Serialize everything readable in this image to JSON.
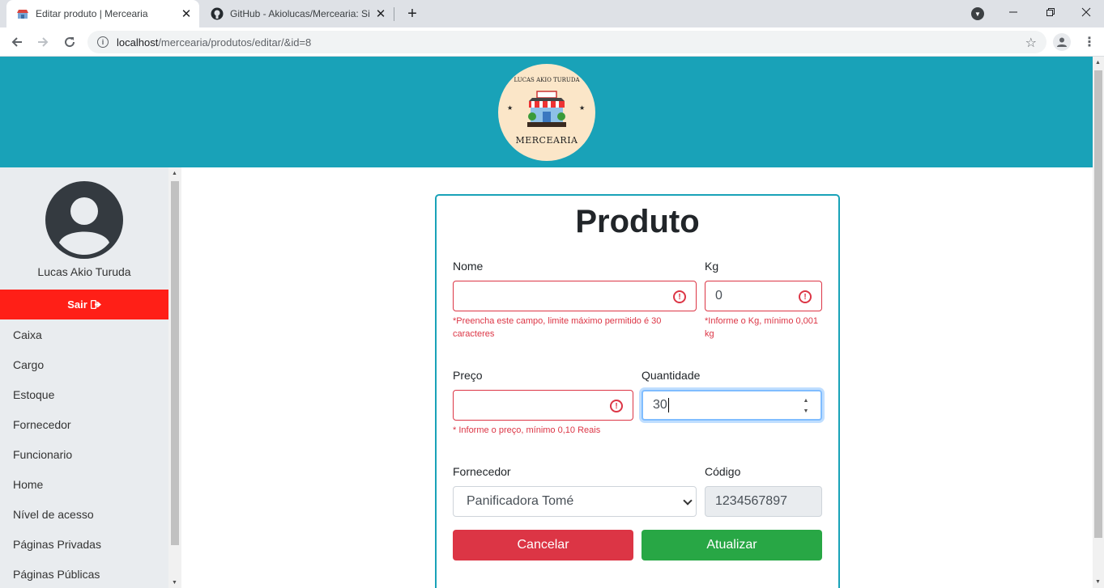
{
  "browser": {
    "tabs": [
      {
        "title": "Editar produto | Mercearia",
        "favicon": "store-icon",
        "active": true
      },
      {
        "title": "GitHub - Akiolucas/Mercearia: Si",
        "favicon": "github-icon",
        "active": false
      }
    ],
    "url_host": "localhost",
    "url_path": "/mercearia/produtos/editar/&id=8"
  },
  "header": {
    "logo_brand": "MERCEARIA",
    "logo_owner": "LUCAS AKIO TURUDA",
    "color": "#19a2b8"
  },
  "sidebar": {
    "user_name": "Lucas Akio Turuda",
    "logout_label": "Sair",
    "logout_color": "#ff1f17",
    "items": [
      "Caixa",
      "Cargo",
      "Estoque",
      "Fornecedor",
      "Funcionario",
      "Home",
      "Nível de acesso",
      "Páginas Privadas",
      "Páginas Públicas"
    ]
  },
  "form": {
    "title": "Produto",
    "nome": {
      "label": "Nome",
      "value": "",
      "error": "*Preencha este campo, limite máximo permitido é 30 caracteres"
    },
    "kg": {
      "label": "Kg",
      "value": "0",
      "error": "*Informe o Kg, mínimo 0,001 kg"
    },
    "preco": {
      "label": "Preço",
      "value": "",
      "error": "* Informe o preço, mínimo 0,10 Reais"
    },
    "quantidade": {
      "label": "Quantidade",
      "value": "30"
    },
    "fornecedor": {
      "label": "Fornecedor",
      "selected": "Panificadora Tomé"
    },
    "codigo": {
      "label": "Código",
      "value": "1234567897"
    },
    "cancel_label": "Cancelar",
    "submit_label": "Atualizar",
    "error_color": "#dc3545",
    "success_color": "#28a745"
  }
}
